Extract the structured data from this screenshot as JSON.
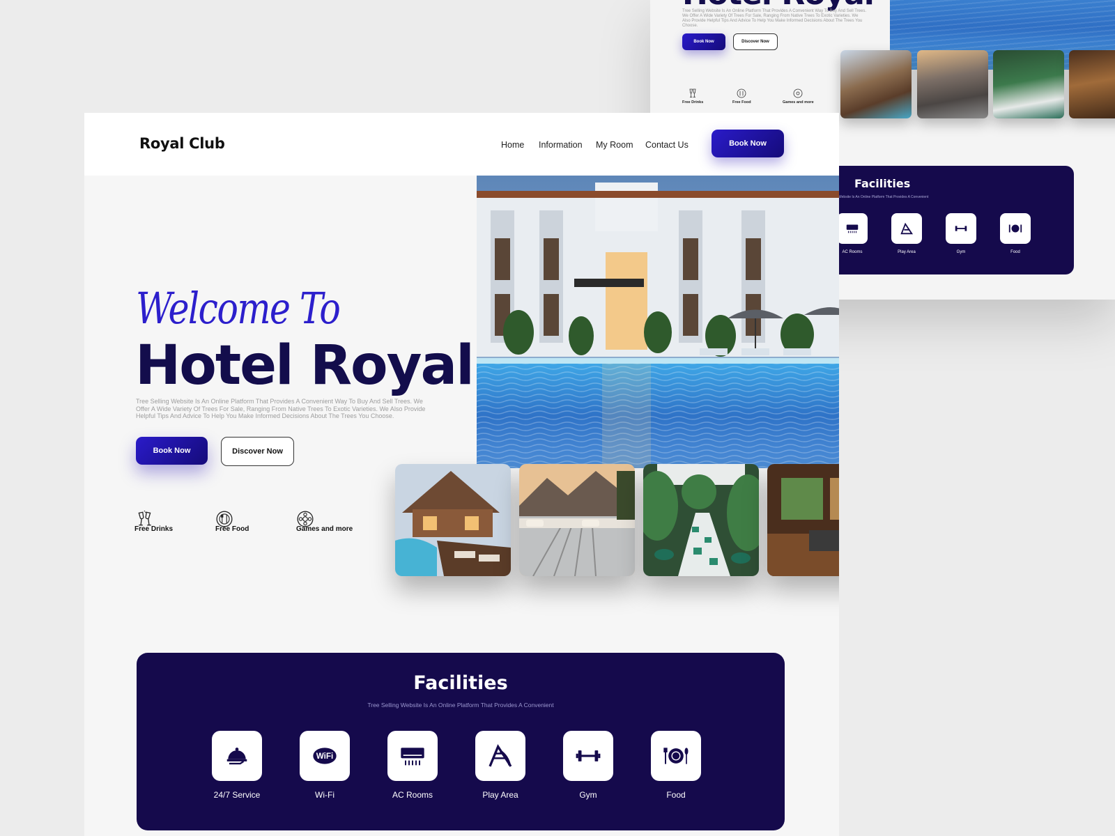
{
  "background_mockup": {
    "title": "Hotel Royal",
    "description": "Tree Selling Website Is An Online Platform That Provides A Convenient Way To Buy And Sell Trees. We Offer A Wide Variety Of Trees For Sale, Ranging From Native Trees To Exotic Varieties. We Also Provide Helpful Tips And Advice To Help You Make Informed Decisions About The Trees You Choose.",
    "book_now": "Book Now",
    "discover_now": "Discover Now",
    "features": [
      "Free Drinks",
      "Free Food",
      "Games and more"
    ],
    "facilities": {
      "title": "Facilities",
      "subtitle": "Website Is An Online Platform That Provides A Convenient",
      "items": [
        "AC Rooms",
        "Play Area",
        "Gym",
        "Food"
      ]
    }
  },
  "nav": {
    "logo": "Royal Club",
    "links": [
      "Home",
      "Information",
      "My Room",
      "Contact Us"
    ],
    "cta": "Book Now"
  },
  "hero": {
    "welcome": "Welcome To",
    "title": "Hotel Royal",
    "description": "Tree Selling Website Is An Online Platform That Provides A Convenient Way To Buy And Sell Trees. We Offer A Wide Variety Of Trees For Sale, Ranging From Native Trees To Exotic Varieties. We Also Provide Helpful Tips And Advice To Help You Make Informed Decisions About The Trees You Choose.",
    "book_now": "Book Now",
    "discover_now": "Discover Now"
  },
  "features": [
    {
      "label": "Free Drinks",
      "icon": "champagne-glasses-icon"
    },
    {
      "label": "Free Food",
      "icon": "plate-cutlery-icon"
    },
    {
      "label": "Games and more",
      "icon": "game-reel-icon"
    }
  ],
  "gallery": [
    {
      "icon": "lakeside-cabin-photo"
    },
    {
      "icon": "mountain-pool-photo"
    },
    {
      "icon": "garden-courtyard-photo"
    },
    {
      "icon": "hotel-interior-photo"
    }
  ],
  "facilities": {
    "title": "Facilities",
    "subtitle": "Tree Selling Website Is An Online Platform That Provides A Convenient",
    "items": [
      {
        "label": "24/7 Service",
        "icon": "room-service-icon"
      },
      {
        "label": "Wi-Fi",
        "icon": "wifi-icon"
      },
      {
        "label": "AC Rooms",
        "icon": "air-conditioner-icon"
      },
      {
        "label": "Play Area",
        "icon": "playground-slide-icon"
      },
      {
        "label": "Gym",
        "icon": "dumbbell-icon"
      },
      {
        "label": "Food",
        "icon": "plate-cutlery-icon"
      }
    ]
  },
  "colors": {
    "brand_navy": "#130d4c",
    "accent_violet": "#2c1fcc",
    "facilities_bg": "#150a4c"
  }
}
